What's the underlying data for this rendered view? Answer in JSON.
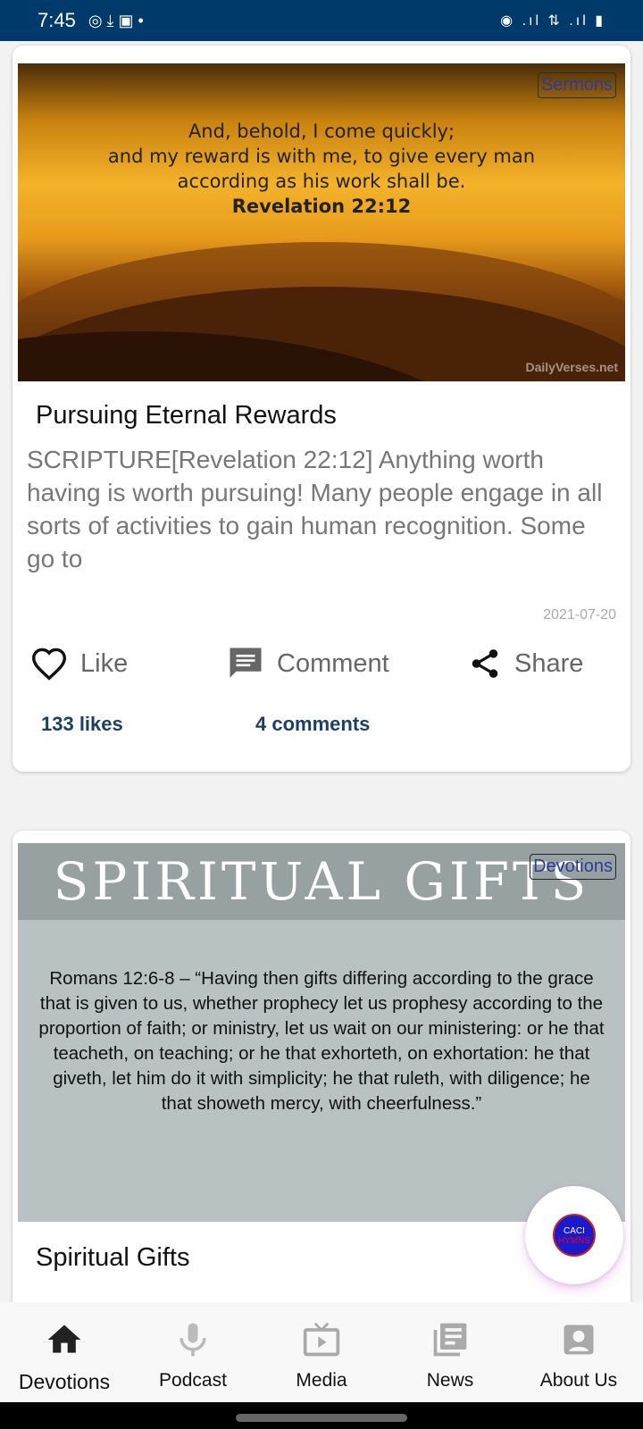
{
  "status_bar": {
    "time": "7:45",
    "right": "◉ .ıl ⇅ .ıl ▮"
  },
  "posts": [
    {
      "category": "Sermons",
      "image_verse": [
        "And, behold, I come quickly;",
        "and my reward is with me, to give every man",
        "according as his work shall be."
      ],
      "image_ref": "Revelation 22:12",
      "image_watermark": "DailyVerses.net",
      "title": "Pursuing Eternal Rewards",
      "excerpt": "SCRIPTURE[Revelation 22:12] Anything worth having is worth pursuing! Many people engage in all sorts of activities to gain human recognition. Some go to",
      "date": "2021-07-20",
      "like_label": "Like",
      "comment_label": "Comment",
      "share_label": "Share",
      "likes": "133 likes",
      "comments": "4 comments"
    },
    {
      "category": "Devotions",
      "image_heading": "SPIRITUAL GIFTS",
      "image_verse": "Romans 12:6-8 – “Having then gifts differing according to the grace that is given to us, whether prophecy let us prophesy according to the proportion of faith; or ministry, let us wait on our ministering:  or he that teacheth, on teaching; or he that exhorteth, on exhortation:  he that giveth, let him do it with simplicity; he that ruleth, with diligence; he that showeth mercy, with cheerfulness.”",
      "title": "Spiritual Gifts"
    }
  ],
  "fab": {
    "line1": "CACI",
    "line2": "HYMNS"
  },
  "nav": [
    {
      "label": "Devotions",
      "icon": "home-icon",
      "active": true
    },
    {
      "label": "Podcast",
      "icon": "mic-icon"
    },
    {
      "label": "Media",
      "icon": "tv-icon"
    },
    {
      "label": "News",
      "icon": "news-icon"
    },
    {
      "label": "About Us",
      "icon": "account-icon"
    }
  ],
  "colors": {
    "status_bar": "#003a6b",
    "counts": "#1b3f66",
    "tag_text": "#2d3b9a"
  }
}
